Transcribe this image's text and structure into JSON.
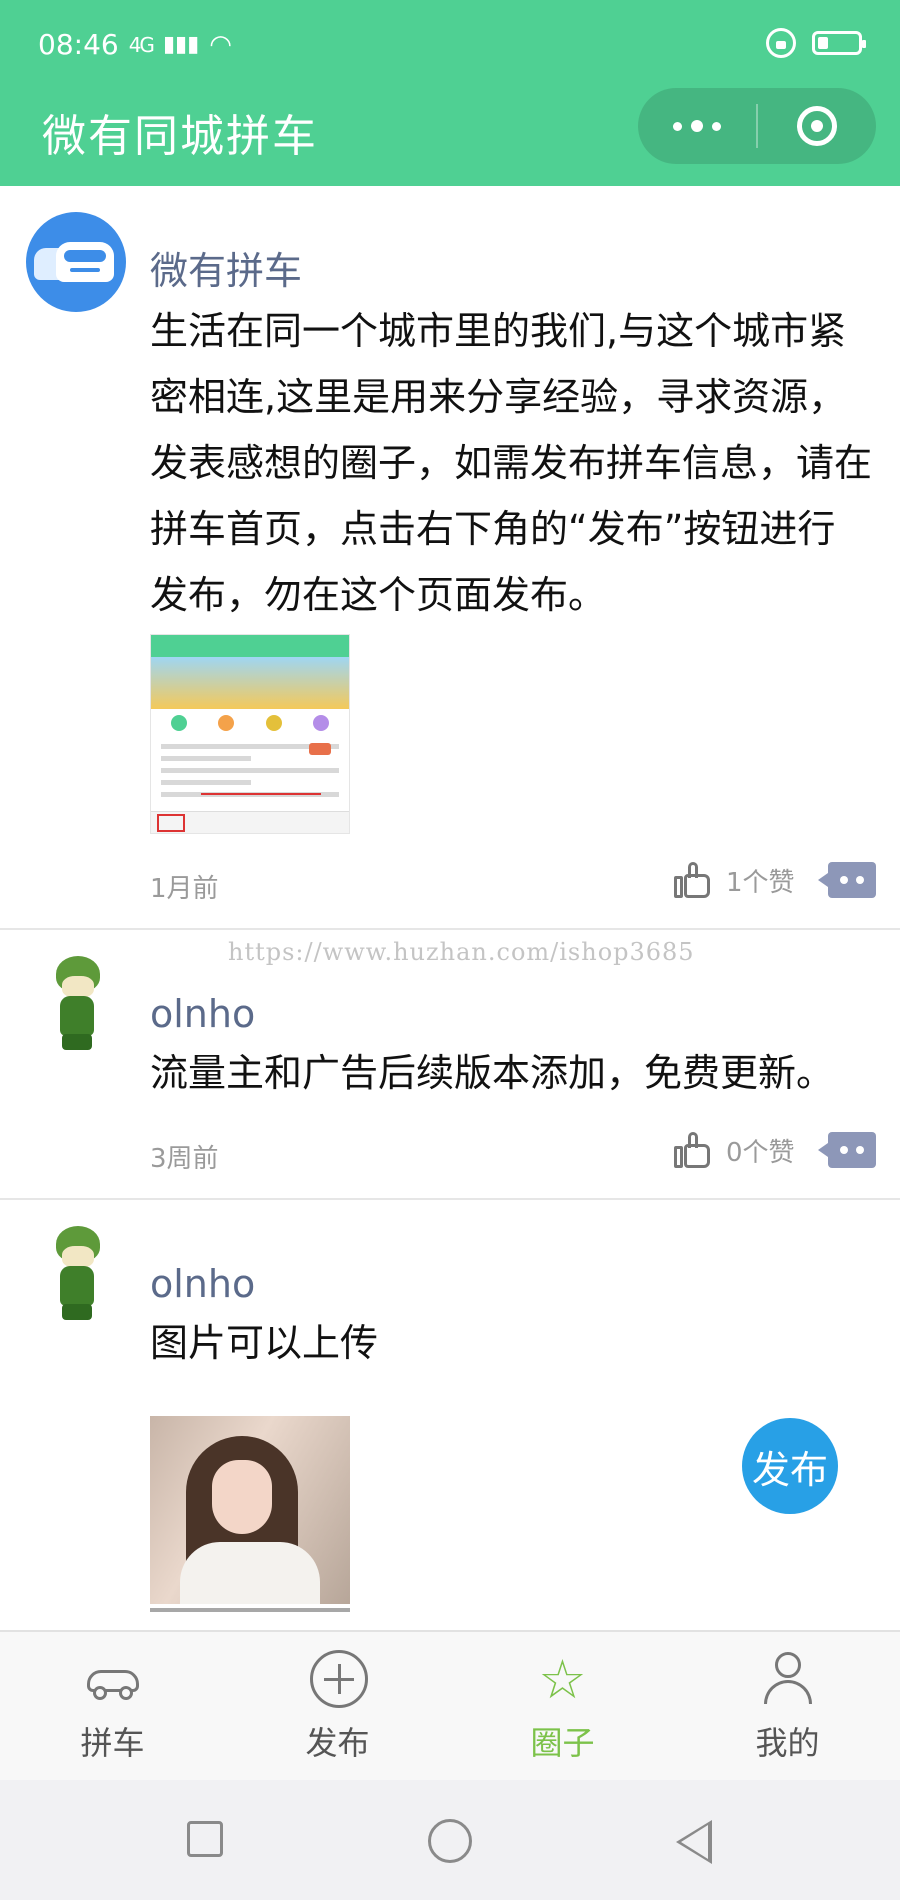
{
  "status_bar": {
    "time": "08:46",
    "network": "4G"
  },
  "header": {
    "title": "微有同城拼车",
    "more_icon": "more-dots-icon",
    "close_icon": "close-target-icon"
  },
  "posts": [
    {
      "author": "微有拼车",
      "content": "生活在同一个城市里的我们,与这个城市紧密相连,这里是用来分享经验，寻求资源，发表感想的圈子，如需发布拼车信息，请在拼车首页，点击右下角的“发布”按钮进行发布，勿在这个页面发布。",
      "time": "1月前",
      "likes": "1个赞",
      "has_image": true
    },
    {
      "author": "olnho",
      "content": "流量主和广告后续版本添加，免费更新。",
      "time": "3周前",
      "likes": "0个赞",
      "has_image": false
    },
    {
      "author": "olnho",
      "content": "图片可以上传",
      "time": "",
      "likes": "",
      "has_image": true
    }
  ],
  "watermark": "https://www.huzhan.com/ishop3685",
  "fab": {
    "label": "发布"
  },
  "tabs": [
    {
      "label": "拼车",
      "icon": "car-icon",
      "active": false
    },
    {
      "label": "发布",
      "icon": "plus-circle-icon",
      "active": false
    },
    {
      "label": "圈子",
      "icon": "star-icon",
      "active": true
    },
    {
      "label": "我的",
      "icon": "user-icon",
      "active": false
    }
  ],
  "colors": {
    "header": "#4fd093",
    "active_tab": "#7cc24a",
    "fab": "#28a0e6",
    "author": "#5b6a8a"
  }
}
